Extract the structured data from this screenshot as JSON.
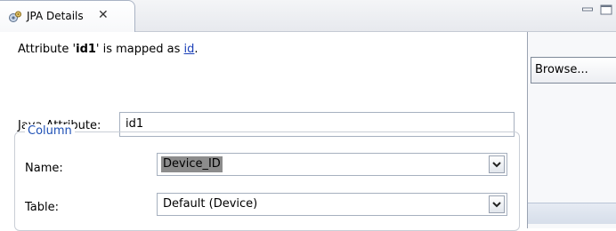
{
  "view_tab": {
    "title": "JPA Details",
    "close_glyph": "✕"
  },
  "mapping": {
    "prefix": "Attribute '",
    "attribute": "id1",
    "middle": "' is mapped as ",
    "mapping_link": "id",
    "suffix": "."
  },
  "java_attribute": {
    "label": "Java Attribute:",
    "value": "id1"
  },
  "column_group": {
    "title": "Column",
    "name_label": "Name:",
    "name_value": "Device_ID",
    "table_label": "Table:",
    "table_value": "Default (Device)"
  },
  "background_editor": {
    "browse_label": "Browse..."
  },
  "colors": {
    "link": "#1a3fb8",
    "group_title": "#1d4fb5",
    "selection": "#8c8c8c"
  }
}
